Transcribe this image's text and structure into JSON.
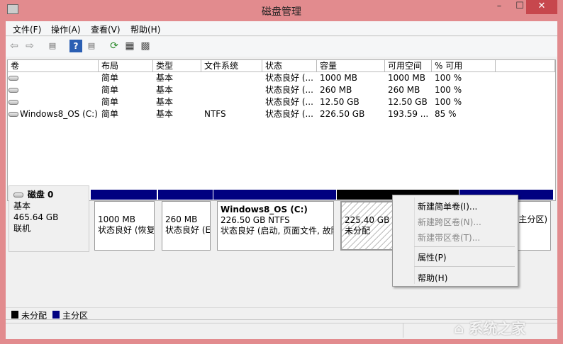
{
  "window": {
    "title": "磁盘管理",
    "minimize": "–",
    "maximize": "☐",
    "close": "✕"
  },
  "menu": [
    "文件(F)",
    "操作(A)",
    "查看(V)",
    "帮助(H)"
  ],
  "toolbar": {
    "icons": [
      "back-icon",
      "forward-icon",
      "show-hide-console-tree-icon",
      "help-icon",
      "show-action-pane-icon",
      "refresh-icon",
      "properties-icon",
      "rescan-icon"
    ]
  },
  "table": {
    "headers": [
      "卷",
      "布局",
      "类型",
      "文件系统",
      "状态",
      "容量",
      "可用空间",
      "% 可用"
    ],
    "rows": [
      [
        "",
        "简单",
        "基本",
        "",
        "状态良好 (...",
        "1000 MB",
        "1000 MB",
        "100 %"
      ],
      [
        "",
        "简单",
        "基本",
        "",
        "状态良好 (...",
        "260 MB",
        "260 MB",
        "100 %"
      ],
      [
        "",
        "简单",
        "基本",
        "",
        "状态良好 (...",
        "12.50 GB",
        "12.50 GB",
        "100 %"
      ],
      [
        "Windows8_OS (C:)",
        "简单",
        "基本",
        "NTFS",
        "状态良好 (...",
        "226.50 GB",
        "193.59 ...",
        "85 %"
      ]
    ]
  },
  "disk": {
    "name": "磁盘 0",
    "type": "基本",
    "size": "465.64 GB",
    "status": "联机",
    "partitions": [
      {
        "title": "",
        "size": "1000 MB",
        "status": "状态良好 (恢复"
      },
      {
        "title": "",
        "size": "260 MB",
        "status": "状态良好 (E"
      },
      {
        "title": "Windows8_OS  (C:)",
        "size": "226.50 GB NTFS",
        "status": "状态良好 (启动, 页面文件, 故障"
      },
      {
        "title": "",
        "size": "225.40 GB",
        "status": "未分配"
      },
      {
        "title": "",
        "size": "",
        "status": "主分区)"
      }
    ]
  },
  "context_menu": {
    "items": [
      {
        "label": "新建简单卷(I)...",
        "enabled": true
      },
      {
        "label": "新建跨区卷(N)...",
        "enabled": false
      },
      {
        "label": "新建带区卷(T)...",
        "enabled": false
      },
      {
        "label": "属性(P)",
        "enabled": true
      },
      {
        "label": "帮助(H)",
        "enabled": true
      }
    ]
  },
  "legend": [
    {
      "label": "未分配",
      "color": "#000000"
    },
    {
      "label": "主分区",
      "color": "#000080"
    }
  ],
  "watermark": "系统之家"
}
